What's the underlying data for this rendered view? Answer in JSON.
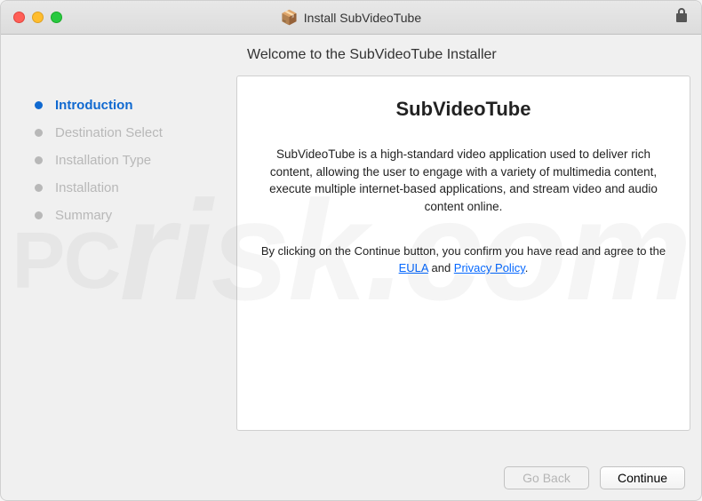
{
  "window": {
    "title": "Install SubVideoTube"
  },
  "header": {
    "welcome": "Welcome to the SubVideoTube Installer"
  },
  "sidebar": {
    "steps": [
      {
        "label": "Introduction",
        "active": true
      },
      {
        "label": "Destination Select",
        "active": false
      },
      {
        "label": "Installation Type",
        "active": false
      },
      {
        "label": "Installation",
        "active": false
      },
      {
        "label": "Summary",
        "active": false
      }
    ]
  },
  "panel": {
    "title": "SubVideoTube",
    "description": "SubVideoTube is a high-standard video application used to deliver rich content, allowing the user to engage with a variety of multimedia content, execute multiple internet-based applications, and stream video and audio content online.",
    "consent_prefix": "By clicking on the Continue button, you confirm you have read and agree to the ",
    "eula_label": "EULA",
    "consent_mid": " and ",
    "privacy_label": "Privacy Policy",
    "consent_end": "."
  },
  "buttons": {
    "go_back": "Go Back",
    "continue": "Continue"
  },
  "watermark": {
    "text": "risk.com"
  }
}
